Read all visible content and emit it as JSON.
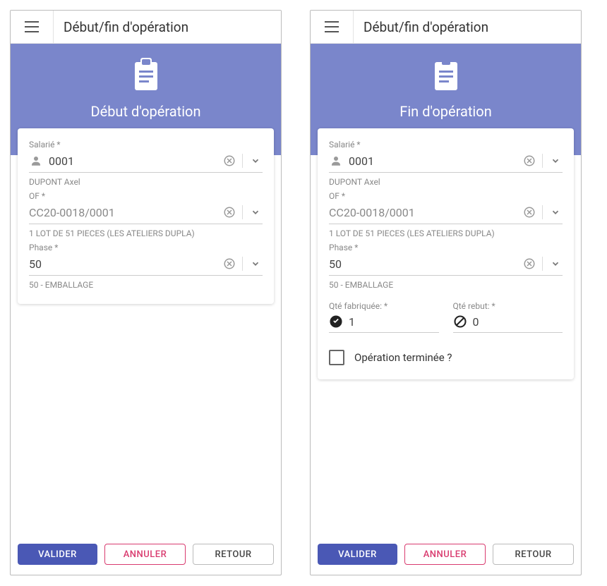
{
  "appbar": {
    "title": "Début/fin d'opération"
  },
  "left": {
    "hero_title": "Début d'opération",
    "salarie": {
      "label": "Salarié *",
      "value": "0001",
      "helper": "DUPONT Axel"
    },
    "of": {
      "label": "OF *",
      "value": "CC20-0018/0001",
      "helper": "1 LOT DE 51 PIECES (LES ATELIERS DUPLA)"
    },
    "phase": {
      "label": "Phase *",
      "value": "50",
      "helper": "50 - EMBALLAGE"
    }
  },
  "right": {
    "hero_title": "Fin d'opération",
    "salarie": {
      "label": "Salarié *",
      "value": "0001",
      "helper": "DUPONT Axel"
    },
    "of": {
      "label": "OF *",
      "value": "CC20-0018/0001",
      "helper": "1 LOT DE 51 PIECES (LES ATELIERS DUPLA)"
    },
    "phase": {
      "label": "Phase *",
      "value": "50",
      "helper": "50 - EMBALLAGE"
    },
    "qty_made": {
      "label": "Qté fabriquée: *",
      "value": "1"
    },
    "qty_scrap": {
      "label": "Qté rebut: *",
      "value": "0"
    },
    "finished_label": "Opération terminée ?"
  },
  "buttons": {
    "validate": "VALIDER",
    "cancel": "ANNULER",
    "back": "RETOUR"
  }
}
